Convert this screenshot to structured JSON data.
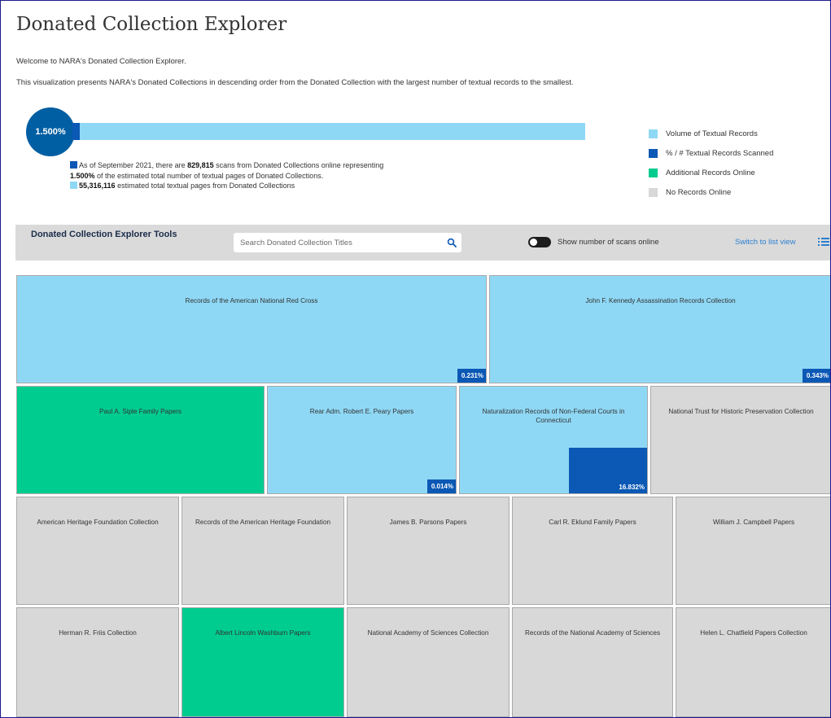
{
  "page": {
    "title": "Donated Collection Explorer",
    "intro1": "Welcome to NARA's Donated Collection Explorer.",
    "intro2": "This visualization presents NARA's Donated Collections in descending order from the Donated Collection with the largest number of textual records to the smallest."
  },
  "summary": {
    "percent_label": "1.500%",
    "percent_scanned": 1.5,
    "stats_line1_prefix": "As of September 2021, there are ",
    "scans": "829,815",
    "stats_line1_mid": " scans from Donated Collections online representing ",
    "stats_percent": "1.500%",
    "stats_line1_suffix": " of the estimated total number of textual pages of Donated Collections.",
    "total_pages": "55,316,116",
    "total_pages_suffix": " estimated total textual pages from Donated Collections"
  },
  "legend": [
    {
      "label": "Volume of Textual Records",
      "color": "#8fd8f5"
    },
    {
      "label": "% / # Textual Records Scanned",
      "color": "#0b58b5"
    },
    {
      "label": "Additional Records Online",
      "color": "#00cc8f"
    },
    {
      "label": "No Records Online",
      "color": "#d8d8d8"
    }
  ],
  "toolbar": {
    "title": "Donated Collection Explorer Tools",
    "search_placeholder": "Search Donated Collection Titles",
    "toggle_label": "Show number of scans online",
    "list_view_link": "Switch to list view"
  },
  "collections": [
    {
      "name": "Records of the American National Red Cross",
      "status": "blue",
      "percent": "0.231%"
    },
    {
      "name": "John F. Kennedy Assassination Records Collection",
      "status": "blue",
      "percent": "0.343%"
    },
    {
      "name": "Paul A. Siple Family Papers",
      "status": "green"
    },
    {
      "name": "Rear Adm. Robert E. Peary Papers",
      "status": "blue",
      "percent": "0.014%"
    },
    {
      "name": "Naturalization Records of Non-Federal Courts in Connecticut",
      "status": "blue",
      "percent": "16.832%",
      "scanned_fraction": 0.168
    },
    {
      "name": "National Trust for Historic Preservation Collection",
      "status": "gray"
    },
    {
      "name": "American Heritage Foundation Collection",
      "status": "gray"
    },
    {
      "name": "Records of the American Heritage Foundation",
      "status": "gray"
    },
    {
      "name": "James B. Parsons Papers",
      "status": "gray"
    },
    {
      "name": "Carl R. Eklund Family Papers",
      "status": "gray"
    },
    {
      "name": "William J. Campbell Papers",
      "status": "gray"
    },
    {
      "name": "Herman R. Friis Collection",
      "status": "gray"
    },
    {
      "name": "Albert Lincoln Washburn Papers",
      "status": "green"
    },
    {
      "name": "National Academy of Sciences Collection",
      "status": "gray"
    },
    {
      "name": "Records of the National Academy of Sciences",
      "status": "gray"
    },
    {
      "name": "Helen L. Chatfield Papers Collection",
      "status": "gray"
    }
  ]
}
